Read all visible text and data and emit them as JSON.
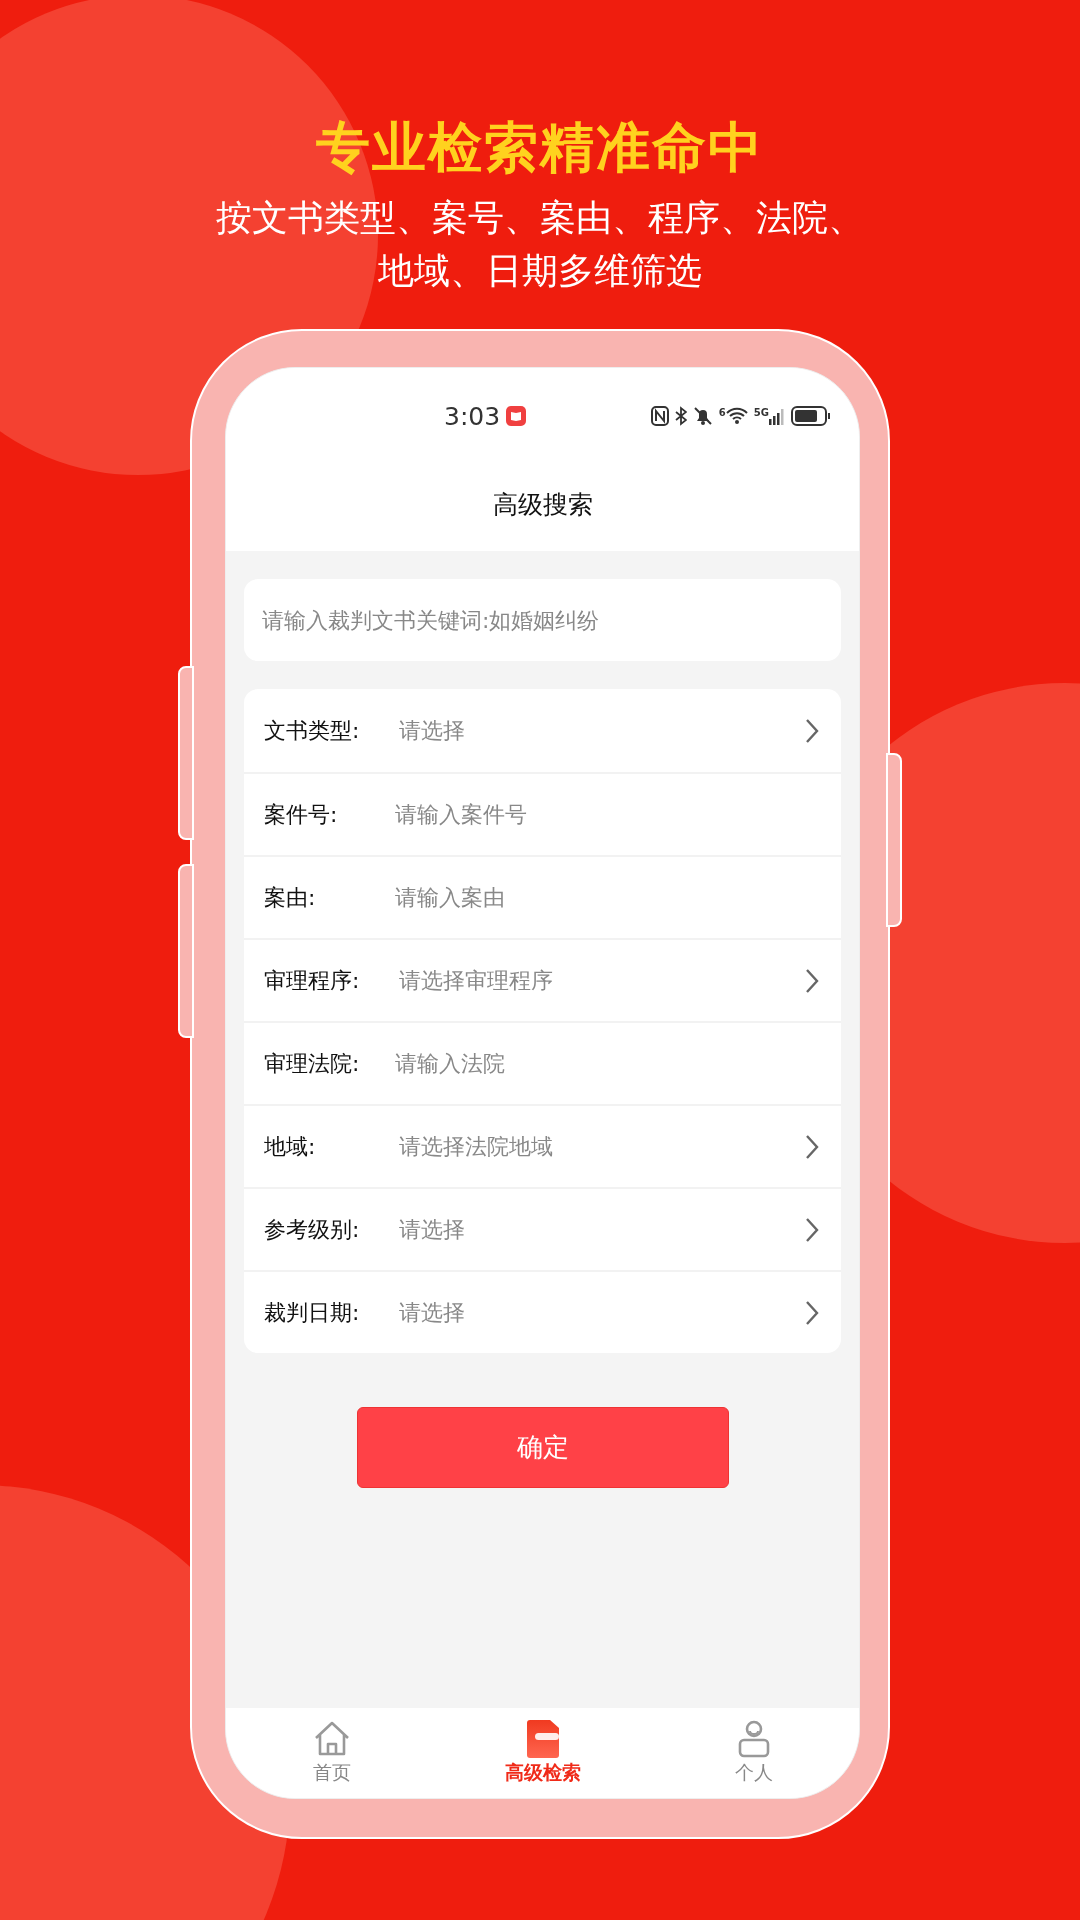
{
  "headline": "专业检索精准命中",
  "subtitle": "按文书类型、案号、案由、程序、法院、地域、日期多维筛选",
  "status_bar": {
    "time": "3:03",
    "network": "5G",
    "wifi_standard": "6"
  },
  "header": {
    "title": "高级搜索"
  },
  "search": {
    "placeholder": "请输入裁判文书关键词:如婚姻纠纷"
  },
  "fields": [
    {
      "kind": "select",
      "label": "文书类型:",
      "placeholder": "请选择"
    },
    {
      "kind": "input",
      "label": "案件号:",
      "placeholder": "请输入案件号"
    },
    {
      "kind": "input",
      "label": "案由:",
      "placeholder": "请输入案由"
    },
    {
      "kind": "select",
      "label": "审理程序:",
      "placeholder": "请选择审理程序"
    },
    {
      "kind": "input",
      "label": "审理法院:",
      "placeholder": "请输入法院"
    },
    {
      "kind": "select",
      "label": "地域:",
      "placeholder": "请选择法院地域"
    },
    {
      "kind": "select",
      "label": "参考级别:",
      "placeholder": "请选择"
    },
    {
      "kind": "select",
      "label": "裁判日期:",
      "placeholder": "请选择"
    }
  ],
  "confirm_button": "确定",
  "tabs": [
    {
      "label": "首页",
      "kind": "home",
      "selected": false
    },
    {
      "label": "高级检索",
      "kind": "search",
      "selected": true
    },
    {
      "label": "个人",
      "kind": "profile",
      "selected": false
    }
  ]
}
